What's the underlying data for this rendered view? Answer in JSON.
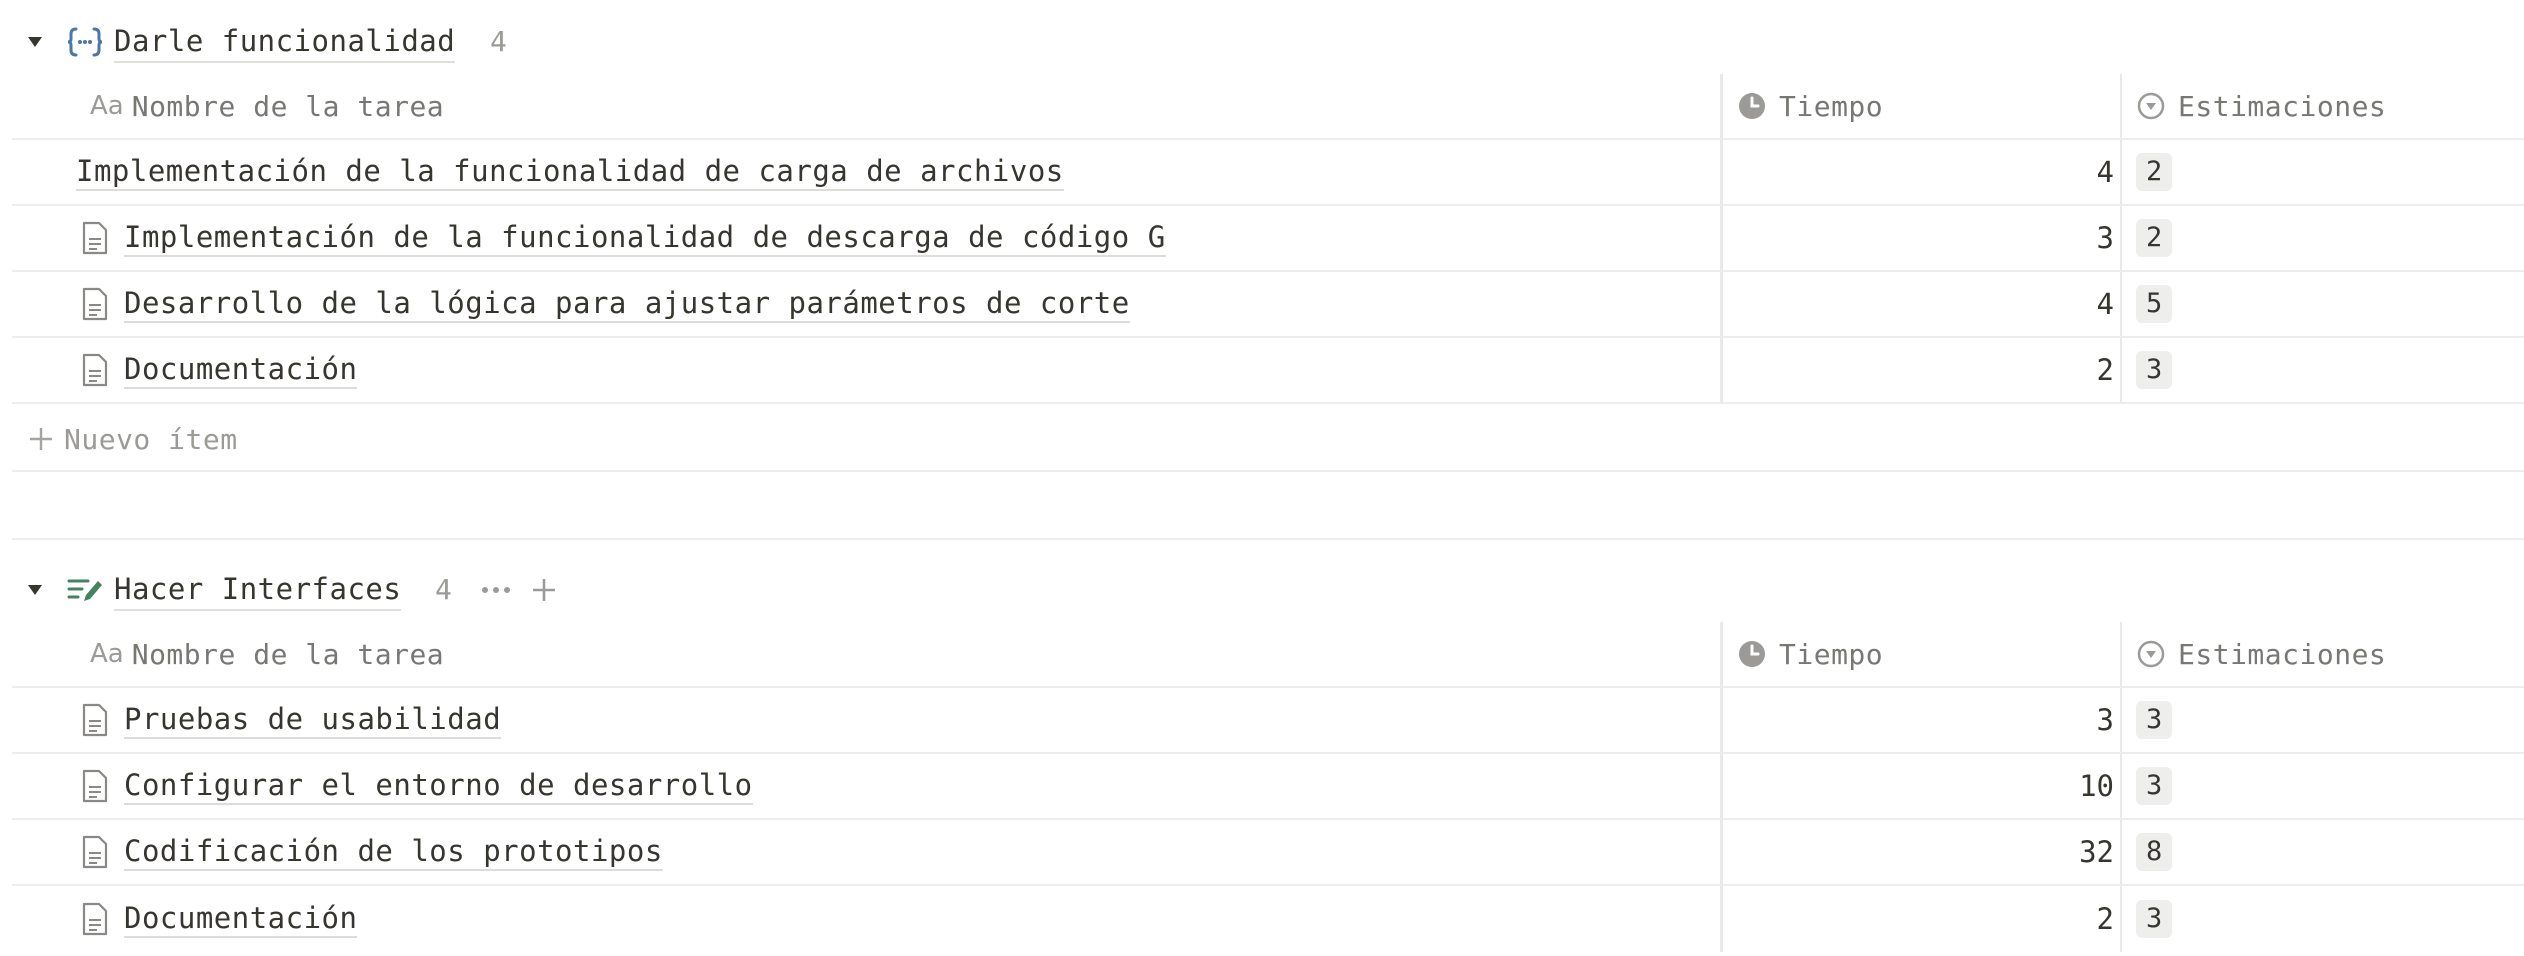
{
  "groups": [
    {
      "title": "Darle funcionalidad",
      "count": "4",
      "icon": "code-braces-icon",
      "icon_color": "#4a76a8",
      "columns": {
        "name": "Nombre de la tarea",
        "aa": "Aa",
        "time": "Tiempo",
        "estimate": "Estimaciones"
      },
      "rows": [
        {
          "name": "Implementación de la funcionalidad de carga de archivos",
          "time": "4",
          "estimate": "2",
          "has_icon": false
        },
        {
          "name": "Implementación de la funcionalidad de descarga de código G",
          "time": "3",
          "estimate": "2",
          "has_icon": true
        },
        {
          "name": "Desarrollo de la lógica para ajustar parámetros de corte",
          "time": "4",
          "estimate": "5",
          "has_icon": true
        },
        {
          "name": "Documentación",
          "time": "2",
          "estimate": "3",
          "has_icon": true
        }
      ],
      "new_item": "Nuevo ítem"
    },
    {
      "title": "Hacer Interfaces",
      "count": "4",
      "icon": "list-edit-icon",
      "icon_color": "#448361",
      "columns": {
        "name": "Nombre de la tarea",
        "aa": "Aa",
        "time": "Tiempo",
        "estimate": "Estimaciones"
      },
      "rows": [
        {
          "name": "Pruebas de usabilidad",
          "time": "3",
          "estimate": "3",
          "has_icon": true
        },
        {
          "name": "Configurar el entorno de desarrollo",
          "time": "10",
          "estimate": "3",
          "has_icon": true
        },
        {
          "name": "Codificación de los prototipos",
          "time": "32",
          "estimate": "8",
          "has_icon": true
        },
        {
          "name": "Documentación",
          "time": "2",
          "estimate": "3",
          "has_icon": true
        }
      ]
    }
  ]
}
